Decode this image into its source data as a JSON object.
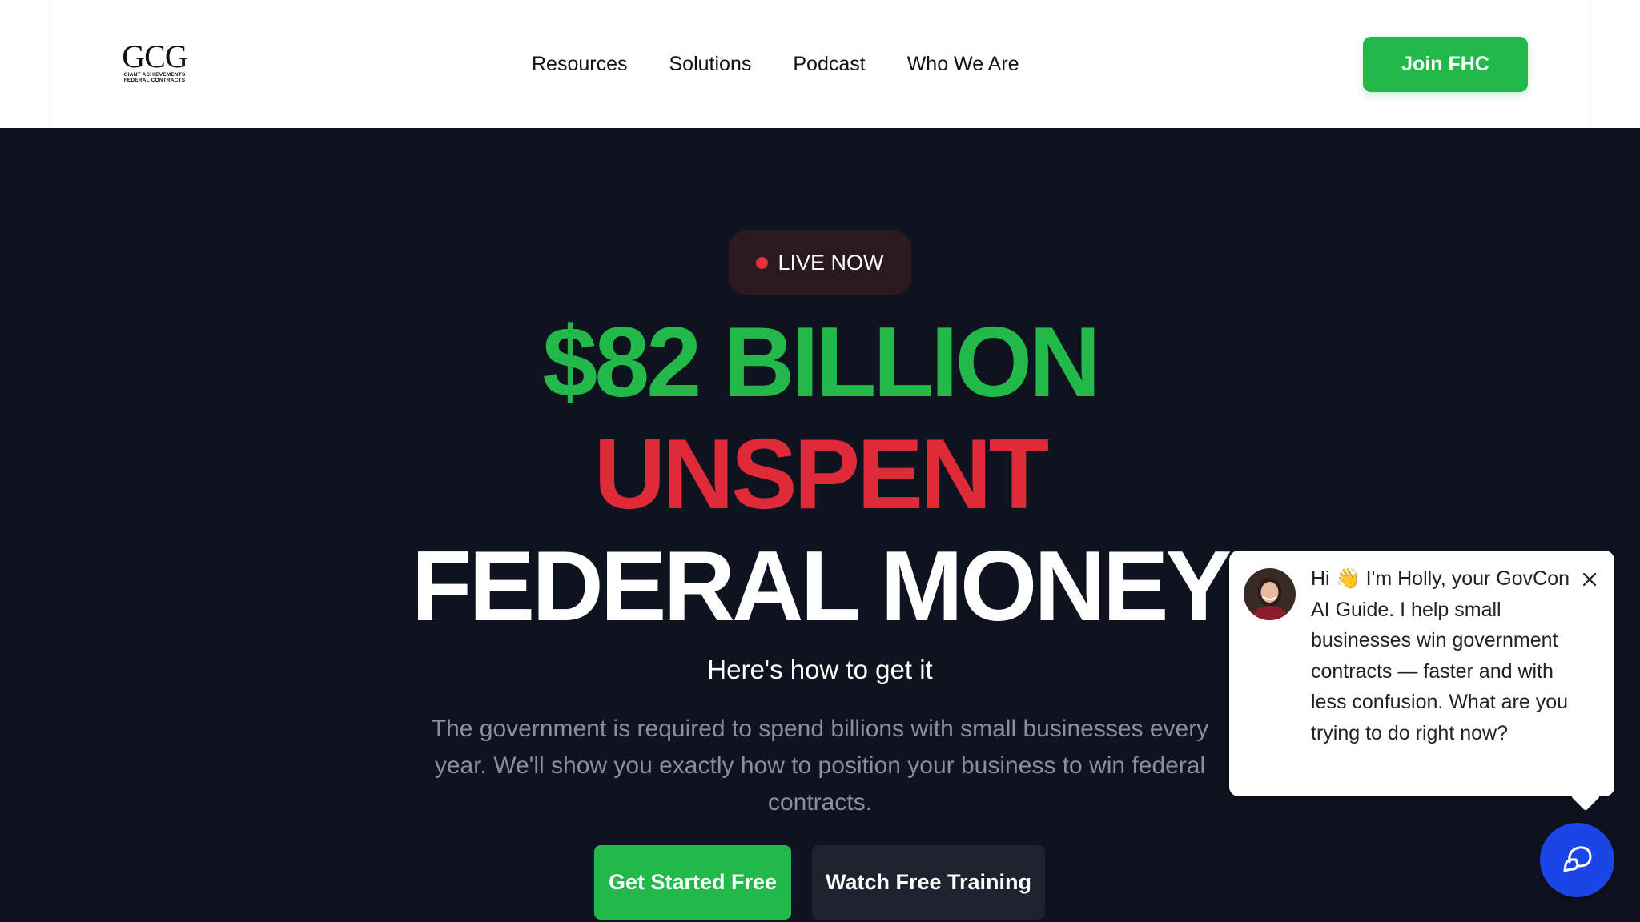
{
  "header": {
    "logo": {
      "mark": "GCG",
      "sub_line1": "GIANT ACHIEVEMENTS",
      "sub_line2": "FEDERAL CONTRACTS"
    },
    "nav": [
      {
        "label": "Resources"
      },
      {
        "label": "Solutions"
      },
      {
        "label": "Podcast"
      },
      {
        "label": "Who We Are"
      }
    ],
    "join_button": "Join FHC"
  },
  "hero": {
    "badge": "LIVE NOW",
    "headline_line1": "$82 BILLION",
    "headline_line2": "UNSPENT",
    "headline_line3": "FEDERAL MONEY",
    "subhead": "Here's how to get it",
    "description": "The government is required to spend billions with small businesses every year. We'll show you exactly how to position your business to win federal contracts.",
    "cta_primary": "Get Started Free",
    "cta_secondary": "Watch Free Training"
  },
  "chat": {
    "message": "Hi 👋 I'm Holly, your GovCon AI Guide. I help small businesses win government contracts — faster and with less confusion. What are you trying to do right now?",
    "close_icon": "close-icon",
    "launcher_icon": "chat-bubble-icon"
  },
  "colors": {
    "brand_green": "#22b94a",
    "alert_red": "#e02a37",
    "hero_bg": "#0f1320",
    "chat_blue": "#1a46e8"
  }
}
